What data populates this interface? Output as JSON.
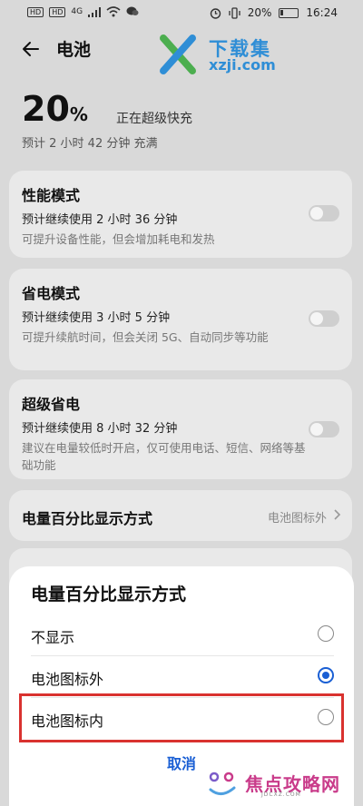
{
  "status_bar": {
    "sim1": "HD",
    "sim2": "HD",
    "network": "4G",
    "battery_percent": "20%",
    "time": "16:24"
  },
  "header": {
    "title": "电池"
  },
  "watermark_top": {
    "brand": "下载集",
    "url": "xzji.com"
  },
  "charge": {
    "percent": "20",
    "unit": "%",
    "status": "正在超级快充",
    "estimate": "预计 2 小时 42 分钟 充满"
  },
  "modes": [
    {
      "title": "性能模式",
      "usage": "预计继续使用 2 小时 36 分钟",
      "desc": "可提升设备性能，但会增加耗电和发热",
      "enabled": false
    },
    {
      "title": "省电模式",
      "usage": "预计继续使用 3 小时 5 分钟",
      "desc": "可提升续航时间，但会关闭 5G、自动同步等功能",
      "enabled": false
    },
    {
      "title": "超级省电",
      "usage": "预计继续使用 8 小时 32 分钟",
      "desc": "建议在电量较低时开启，仅可使用电话、短信、网络等基础功能",
      "enabled": false
    }
  ],
  "percent_display_row": {
    "label": "电量百分比显示方式",
    "value": "电池图标外"
  },
  "sheet": {
    "title": "电量百分比显示方式",
    "options": [
      {
        "label": "不显示",
        "selected": false
      },
      {
        "label": "电池图标外",
        "selected": true
      },
      {
        "label": "电池图标内",
        "selected": false
      }
    ],
    "cancel_label": "取消"
  },
  "watermark_bottom": {
    "brand": "焦点攻略网",
    "url": "JDCXZ.COM"
  },
  "colors": {
    "accent": "#1a5fd4",
    "highlight": "#d9322f",
    "logo_blue": "#2f8ed6",
    "logo_green": "#4cae4f"
  }
}
